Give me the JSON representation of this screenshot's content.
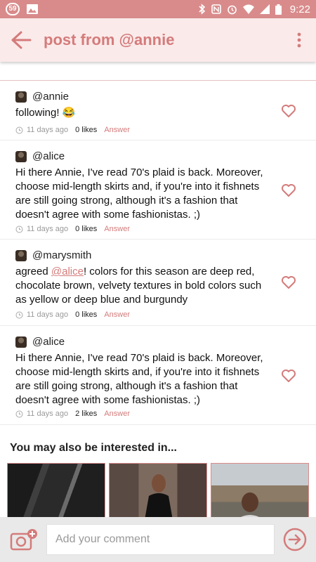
{
  "status_bar": {
    "notification_count": "59",
    "time": "9:22",
    "icons": [
      "image-icon",
      "bluetooth-icon",
      "nfc-icon",
      "alarm-icon",
      "wifi-icon",
      "signal-icon",
      "battery-icon"
    ]
  },
  "header": {
    "title": "post from @annie",
    "icons": [
      "back-arrow-icon",
      "more-vertical-icon"
    ]
  },
  "comments": [
    {
      "username": "@annie",
      "text": "following! 😂",
      "time": "11 days ago",
      "likes": "0 likes",
      "answer": "Answer"
    },
    {
      "username": "@alice",
      "text": "Hi there Annie, I've read 70's plaid is back. Moreover, choose mid-length skirts and, if you're into it fishnets are still going strong, although it's a fashion that doesn't agree with some fashionistas. ;)",
      "time": "11 days ago",
      "likes": "0 likes",
      "answer": "Answer"
    },
    {
      "username": "@marysmith",
      "text_before": "agreed ",
      "mention": "@alice",
      "text_after": "! colors for this season are deep red, chocolate brown, velvety textures in bold colors such as yellow or deep blue and burgundy",
      "time": "11 days ago",
      "likes": "0 likes",
      "answer": "Answer"
    },
    {
      "username": "@alice",
      "text": "Hi there Annie, I've read 70's plaid is back. Moreover, choose mid-length skirts and, if you're into it fishnets are still going strong, although it's a fashion that doesn't agree with some fashionistas. ;)",
      "time": "11 days ago",
      "likes": "2 likes",
      "answer": "Answer"
    }
  ],
  "interest": {
    "title": "You may also be interested in..."
  },
  "composer": {
    "placeholder": "Add your comment",
    "icons": [
      "add-photo-icon",
      "send-arrow-icon"
    ]
  },
  "colors": {
    "accent": "#d47b7b",
    "status_bar": "#d98b8b",
    "app_bar": "#fbeaea",
    "footer": "#e9e9e9"
  }
}
